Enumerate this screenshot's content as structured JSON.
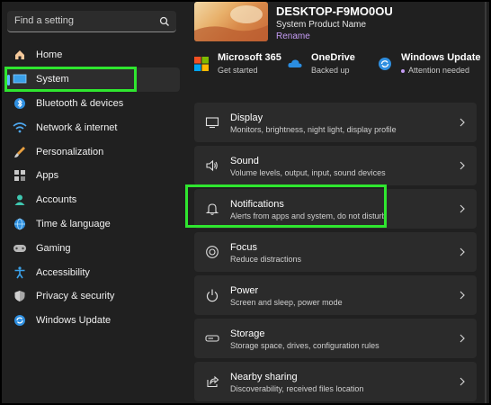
{
  "search": {
    "placeholder": "Find a setting",
    "icon": "search-icon"
  },
  "sidebar": {
    "items": [
      {
        "label": "Home",
        "icon": "home-icon"
      },
      {
        "label": "System",
        "icon": "system-monitor-icon",
        "active": true
      },
      {
        "label": "Bluetooth & devices",
        "icon": "bluetooth-icon"
      },
      {
        "label": "Network & internet",
        "icon": "wifi-icon"
      },
      {
        "label": "Personalization",
        "icon": "brush-icon"
      },
      {
        "label": "Apps",
        "icon": "apps-icon"
      },
      {
        "label": "Accounts",
        "icon": "accounts-icon"
      },
      {
        "label": "Time & language",
        "icon": "globe-clock-icon"
      },
      {
        "label": "Gaming",
        "icon": "gamepad-icon"
      },
      {
        "label": "Accessibility",
        "icon": "accessibility-icon"
      },
      {
        "label": "Privacy & security",
        "icon": "shield-icon"
      },
      {
        "label": "Windows Update",
        "icon": "update-icon"
      }
    ]
  },
  "header": {
    "device_name": "DESKTOP-F9MO0OU",
    "model": "System Product Name",
    "rename_label": "Rename"
  },
  "tiles": [
    {
      "title": "Microsoft 365",
      "subtitle": "Get started",
      "icon": "microsoft-logo-icon"
    },
    {
      "title": "OneDrive",
      "subtitle": "Backed up",
      "icon": "onedrive-cloud-icon"
    },
    {
      "title": "Windows Update",
      "subtitle": "Attention needed",
      "icon": "update-icon"
    }
  ],
  "cards": [
    {
      "title": "Display",
      "subtitle": "Monitors, brightness, night light, display profile",
      "icon": "display-icon"
    },
    {
      "title": "Sound",
      "subtitle": "Volume levels, output, input, sound devices",
      "icon": "speaker-icon"
    },
    {
      "title": "Notifications",
      "subtitle": "Alerts from apps and system, do not disturb",
      "icon": "bell-icon"
    },
    {
      "title": "Focus",
      "subtitle": "Reduce distractions",
      "icon": "focus-icon"
    },
    {
      "title": "Power",
      "subtitle": "Screen and sleep, power mode",
      "icon": "power-icon"
    },
    {
      "title": "Storage",
      "subtitle": "Storage space, drives, configuration rules",
      "icon": "storage-icon"
    },
    {
      "title": "Nearby sharing",
      "subtitle": "Discoverability, received files location",
      "icon": "share-icon"
    }
  ],
  "colors": {
    "highlight": "#2fe62f",
    "accent": "#5eb8ff",
    "link": "#c59cf5",
    "card": "#2b2b2b",
    "background": "#202020"
  }
}
